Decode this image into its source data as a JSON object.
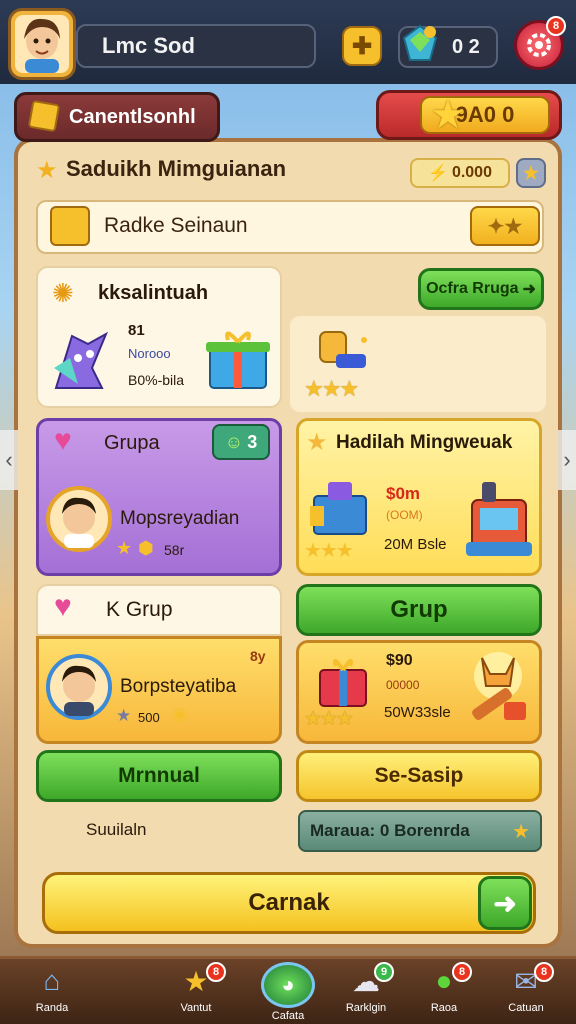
{
  "header": {
    "player_name": "Lmc Sod",
    "resource_value": "0 2",
    "settings_badge": "8"
  },
  "panel": {
    "tab_title": "Canentlsonhl",
    "gold_value": "9A0 0",
    "section_title": "Saduikh Mimguianan",
    "coin_value": "0.000",
    "search_label": "Radke Seinaun",
    "event_card": {
      "title": "kksalintuah",
      "line1": "81",
      "line2": "Norooo",
      "line3": "B0%-bila"
    },
    "action_button": "Ocfra Rruga",
    "group_card": {
      "title": "Grupa",
      "badge": "3",
      "member": "Mopsreyadian",
      "meta": "58r"
    },
    "reward_card": {
      "title": "Hadilah Mingweuak",
      "price": "$0m",
      "sub": "(OOM)",
      "count": "20M Bsle"
    },
    "group2_card": {
      "title": "K Grup",
      "badge": "8y",
      "member": "Borpsteyatiba",
      "meta": "500"
    },
    "grup_button": "Grup",
    "reward2_card": {
      "price": "$90",
      "sub": "00000",
      "count": "50W33sle"
    },
    "manual_button": "Mrnnual",
    "setup_button": "Se-Sasip",
    "footer_left": "Suuilaln",
    "footer_right": "Maraua: 0 Borenrda",
    "cta_label": "Carnak"
  },
  "nav": [
    {
      "label": "Randa",
      "badge": ""
    },
    {
      "label": "Vantut",
      "badge": "8"
    },
    {
      "label": "Cafata",
      "badge": ""
    },
    {
      "label": "Rarklgin",
      "badge": "9"
    },
    {
      "label": "Raoa",
      "badge": "8"
    },
    {
      "label": "Catuan",
      "badge": "8"
    }
  ]
}
